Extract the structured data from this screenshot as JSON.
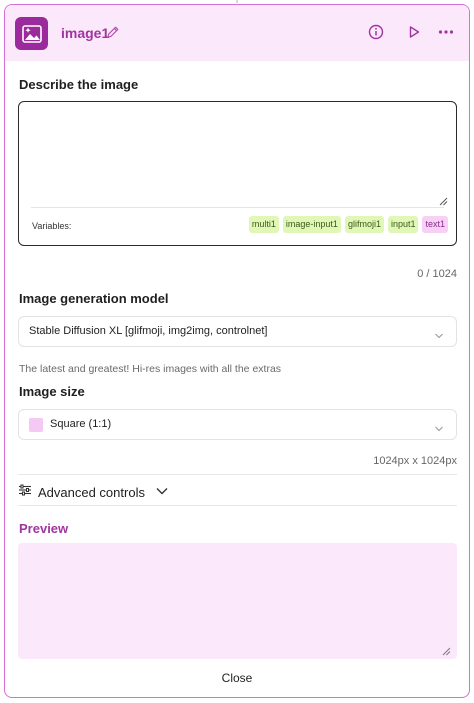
{
  "node": {
    "title": "image1",
    "icon": "image-sparkle-icon",
    "accent_color": "#a0359f",
    "header_bg": "#fbe8fb"
  },
  "header_actions": {
    "info": "info-icon",
    "run": "play-icon",
    "more": "more-horizontal-icon"
  },
  "prompt": {
    "label": "Describe the image",
    "value": "",
    "variables_label": "Variables:",
    "variables": [
      {
        "name": "multi1",
        "color": "green"
      },
      {
        "name": "image-input1",
        "color": "green"
      },
      {
        "name": "glifmoji1",
        "color": "green"
      },
      {
        "name": "input1",
        "color": "green"
      },
      {
        "name": "text1",
        "color": "pink"
      }
    ],
    "char_count": "0 / 1024"
  },
  "model": {
    "label": "Image generation model",
    "selected": "Stable Diffusion XL [glifmoji, img2img, controlnet]",
    "hint": "The latest and greatest! Hi-res images with all the extras"
  },
  "size": {
    "label": "Image size",
    "selected": "Square (1:1)",
    "readout": "1024px x 1024px"
  },
  "advanced": {
    "label": "Advanced controls"
  },
  "preview": {
    "label": "Preview"
  },
  "footer": {
    "close_label": "Close"
  }
}
